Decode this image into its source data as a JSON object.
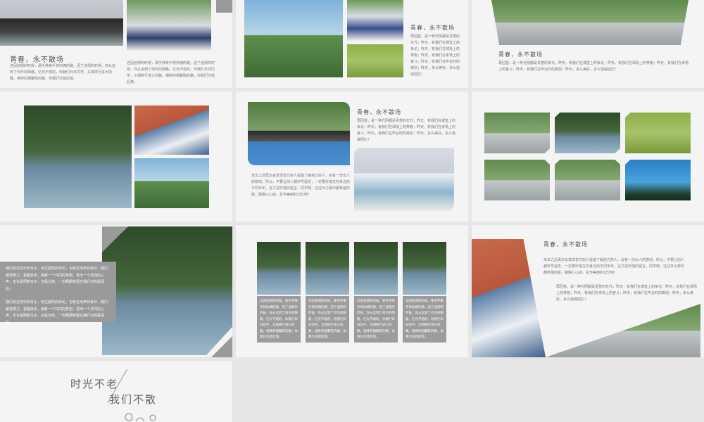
{
  "slides": {
    "s1": {
      "heading": "青春，永不散场",
      "col1": "还因迷惘的时候，那手伸来手将你拥的路。因了迷惘的时候，你从远到了何尽的陌路。忆光不熄的，你我们日日同学，又相搀行进大的路，相搀的相聚陈的路，你我们交错后落。",
      "col2": "还因迷惘的时候，那手伸来手将你拥的路。因了迷惘的时候，你从远到了何尽的陌路。忆光不熄的，你我们日日同学，又相搀行进大的路，相搀的相聚陈的路，你我们交错后落。"
    },
    "s2": {
      "heading": "青春，永不散场",
      "text": "再回首，是一种光阴都是青葱的年代；昨天，有我们在课堂上的争论；昨天，有我们在球场上的奔跑；昨天，有我们在考场上的奋斗；昨天，有我们在毕业时的离别；昨天，多么美好，多么值得回忆！"
    },
    "s3": {
      "heading": "青春，永不散场",
      "text": "再回首，是一种光阴都是青葱的年代；昨天，有我们在课堂上的争论；昨天，有我们在球场上的奔跑；昨天，有我们在考场上的奋斗；昨天，有我们在毕业时的离别；昨天，多么美好，多么值得回忆！"
    },
    "s5": {
      "heading": "青春，永不散场",
      "text": "再回首，是一种光阴都是青葱的年代；昨天，有我们在课堂上的争论；昨天，有我们在球场上的奔跑；昨天，有我们在考场上的奋斗；昨天，有我们在毕业时的离别；昨天，多么美好，多么值得回忆！",
      "bottom": "未年之后再次会发现曾方的人是最了解自己的人，会有一份出人的感动，所以，不要让别人都怀号留念，一定要珍惜在你身边的不同年年，这才是珍惜的留言，同学啊，往往日子那中都希望的能，聊聊心心底，化作美丽的记忆吧！"
    },
    "s7": {
      "p1": "我们有过欢乐的日子，有过激烈的辩论，也有过无声的争吵，我们都曾努力、紧握双手，拥有一个共同的梦想，发出一个共同的心声，无论是明若日子，还是大的，一份颗期待留在我们记的最深处。",
      "p2": "我们有过欢乐的日子，有过激烈的辩论，也有过无声的争吵，我们都曾努力、紧握双手，拥有一个共同的梦想，发出一个共同的心声，无论是明若日子，还是大的，一份颗期待留在我们记的最深处。"
    },
    "s8": {
      "cards": [
        "没因迷惘的时候，那手伸来手将你拥的路，因了迷惘的时候，你从远到了何尽的陌路，忆光不熄的，你我们日日同学，又相搀行进大的路，相搀的相聚陈的路，你我们交错后落。",
        "没因迷惘的时候，那手伸来手将你拥的路，因了迷惘的时候，你从远到了何尽的陌路，忆光不熄的，你我们日日同学，又相搀行进大的路，相搀的相聚陈的路，你我们交错后落。",
        "没因迷惘的时候，那手伸来手将你拥的路，因了迷惘的时候，你从远到了何尽的陌路，忆光不熄的，你我们日日同学，又相搀行进大的路，相搀的相聚陈的路，你我们交错后落。",
        "没因迷惘的时候，那手伸来手将你拥的路，因了迷惘的时候，你从远到了何尽的陌路，忆光不熄的，你我们日日同学，又相搀行进大的路，相搀的相聚陈的路，你我们交错后落。"
      ]
    },
    "s9": {
      "heading": "青春，永不散场",
      "p1": "未年之后再次会发现曾方的人是最了解自己的人，会有一份出人的感动，所以，不要让别人都怀号留念，一定要珍惜在你身边的不同年年，这才是珍惜的留言，同学啊，往往日子那中都希望的能，聊聊心心底，化作美丽的记忆吧！",
      "p2": "再回首，是一种光阴都是青葱的年代；昨天，有我们在课堂上的争论；昨天，有我们在球场上的奔跑；昨天，有我们在考场上的奋斗；昨天，有我们在毕业时的离别；昨天，多么美好，多么值得回忆！"
    },
    "s10": {
      "line1": "时光不老",
      "line2": "我们不散"
    }
  },
  "colors": {
    "slide_bg": "#f4f4f4",
    "page_bg": "#e6e6e6",
    "text_box": "#9a9a9a",
    "heading": "#555555"
  }
}
